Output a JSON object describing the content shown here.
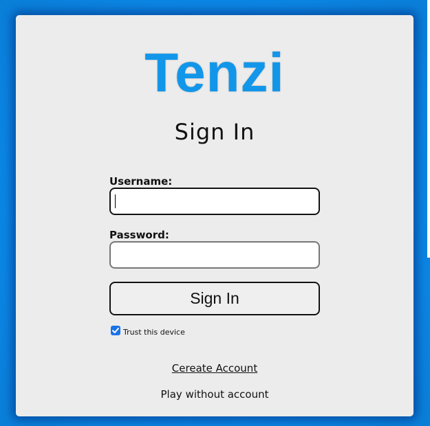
{
  "app": {
    "logo_text": "Tenzi",
    "logo_color": "#1296ea",
    "background_color": "#0b87e6",
    "card_color": "#ececec"
  },
  "form": {
    "title": "Sign In",
    "username_label": "Username:",
    "username_value": "",
    "password_label": "Password:",
    "password_value": "",
    "submit_label": "Sign In",
    "trust_label": "Trust this device",
    "trust_checked": true,
    "checkbox_color": "#1a73e8"
  },
  "links": {
    "create_account": "Cereate Account",
    "play_without_account": "Play without account"
  }
}
